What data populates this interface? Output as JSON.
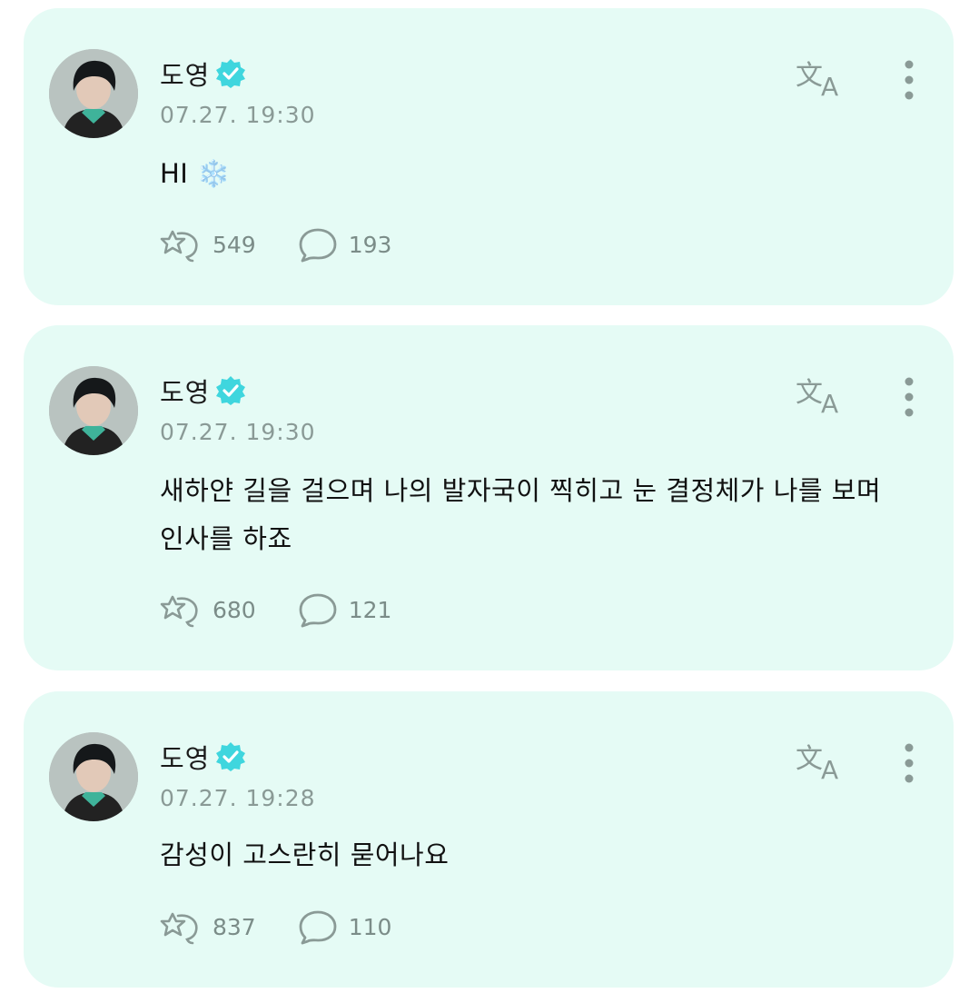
{
  "posts": [
    {
      "author": "도영",
      "time": "07.27. 19:30",
      "text": "HI ❄️",
      "likes": "549",
      "comments": "193"
    },
    {
      "author": "도영",
      "time": "07.27. 19:30",
      "text": "새하얀 길을 걸으며 나의 발자국이 찍히고 눈 결정체가 나를 보며 인사를 하죠",
      "likes": "680",
      "comments": "121"
    },
    {
      "author": "도영",
      "time": "07.27. 19:28",
      "text": "감성이 고스란히 묻어나요",
      "likes": "837",
      "comments": "110"
    }
  ],
  "icons": {
    "verified": "verified-badge-icon",
    "translate": "translate-icon",
    "more": "more-vertical-icon",
    "like": "star-reaction-icon",
    "comment": "comment-bubble-icon"
  },
  "colors": {
    "card_background": "#e5fbf5",
    "verified": "#3fd6de",
    "icon_gray": "#8a9a96"
  }
}
